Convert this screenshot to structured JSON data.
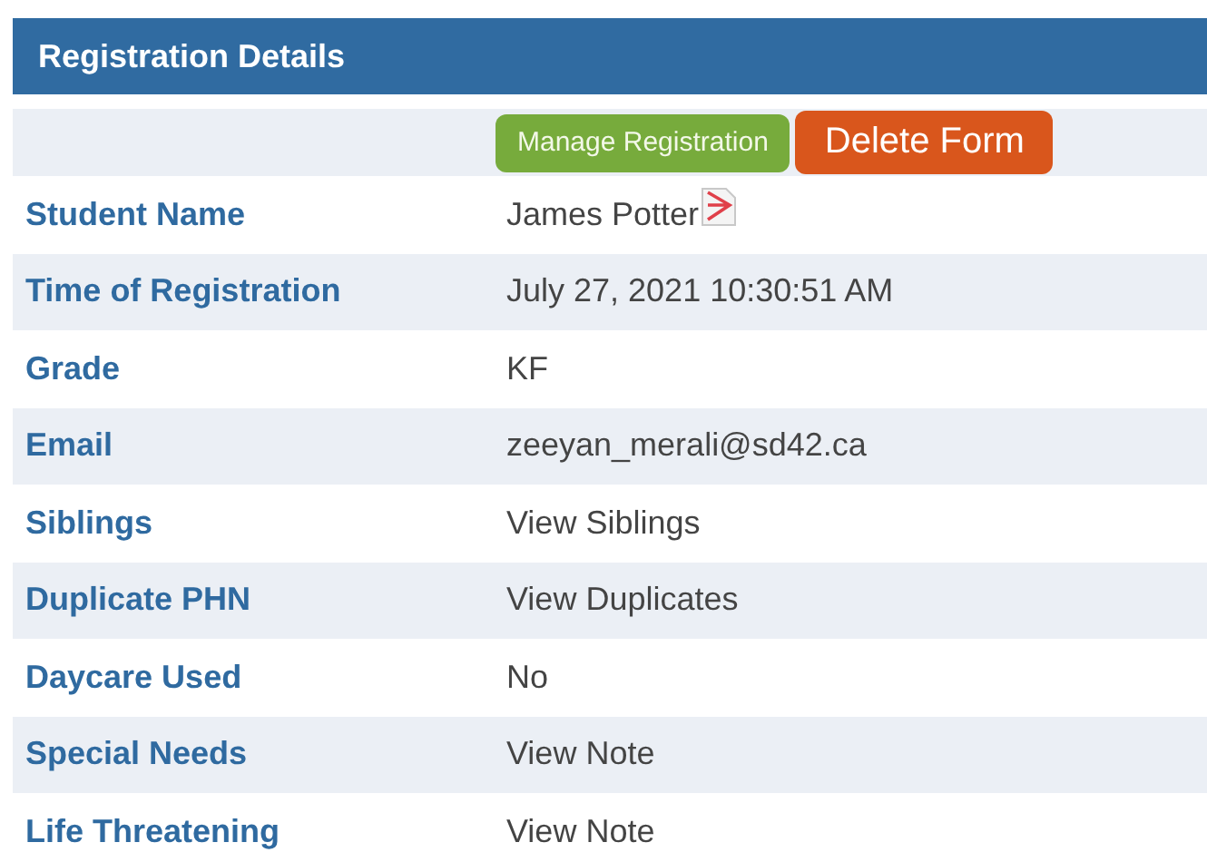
{
  "panel": {
    "title": "Registration Details"
  },
  "actions": [
    {
      "label": "Manage Registration",
      "kind": "primary"
    },
    {
      "label": "Delete Form",
      "kind": "danger"
    }
  ],
  "rows": [
    {
      "label": "Student Name",
      "value": "James Potter",
      "pdf_icon": true
    },
    {
      "label": "Time of Registration",
      "value": "July 27, 2021 10:30:51 AM"
    },
    {
      "label": "Grade",
      "value": "KF"
    },
    {
      "label": "Email",
      "value": "zeeyan_merali@sd42.ca"
    },
    {
      "label": "Siblings",
      "value": "View Siblings"
    },
    {
      "label": "Duplicate PHN",
      "value": "View Duplicates"
    },
    {
      "label": "Daycare Used",
      "value": "No"
    },
    {
      "label": "Special Needs",
      "value": "View Note"
    },
    {
      "label": "Life Threatening",
      "value": "View Note"
    }
  ]
}
